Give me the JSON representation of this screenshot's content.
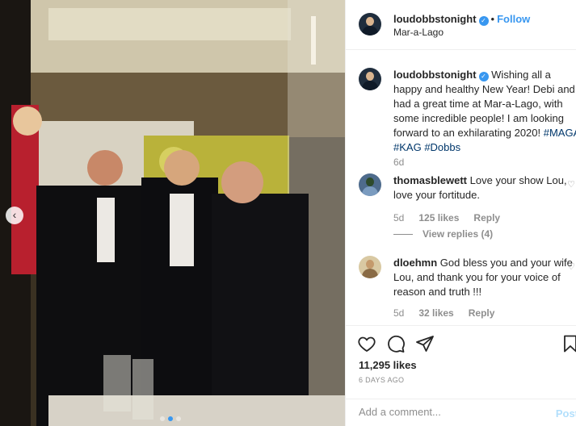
{
  "post": {
    "username": "loudobbstonight",
    "follow_label": "Follow",
    "separator": "•",
    "location": "Mar-a-Lago",
    "caption_text": "Wishing all a happy and healthy New Year! Debi and I had a great time at Mar-a-Lago, with some incredible people! I am looking forward to an exhilarating 2020!",
    "hashtags": [
      "#MAGA",
      "#KAG",
      "#Dobbs"
    ],
    "caption_age": "6d",
    "likes": "11,295 likes",
    "date": "6 DAYS AGO"
  },
  "comments": [
    {
      "username": "thomasblewett",
      "text": "Love your show Lou, love your fortitude.",
      "age": "5d",
      "likes": "125 likes",
      "reply_label": "Reply",
      "view_replies": "View replies (4)"
    },
    {
      "username": "dloehmn",
      "text": "God bless you and your wife Lou, and thank you for your voice of reason and truth !!!",
      "age": "5d",
      "likes": "32 likes",
      "reply_label": "Reply"
    }
  ],
  "composer": {
    "placeholder": "Add a comment...",
    "post_label": "Post"
  },
  "icons": {
    "like": "heart-icon",
    "comment": "comment-icon",
    "share": "share-icon",
    "save": "bookmark-icon",
    "verified": "verified-badge-icon",
    "carousel_prev": "chevron-left-icon"
  },
  "carousel": {
    "count": 3,
    "active_index": 1
  },
  "colors": {
    "link_blue": "#3897f0",
    "hashtag": "#00376b",
    "muted": "#8e8e8e",
    "post_disabled": "#b2dffc"
  }
}
